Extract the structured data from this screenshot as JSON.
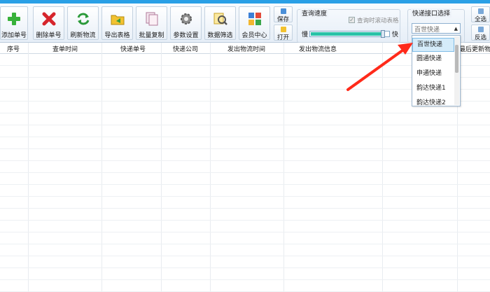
{
  "toolbar": {
    "buttons": [
      {
        "label": "添加单号",
        "icon": "plus-icon"
      },
      {
        "label": "删除单号",
        "icon": "delete-icon"
      },
      {
        "label": "刷新物流",
        "icon": "refresh-icon"
      },
      {
        "label": "导出表格",
        "icon": "export-icon"
      },
      {
        "label": "批量复制",
        "icon": "copy-icon"
      },
      {
        "label": "参数设置",
        "icon": "gear-icon"
      },
      {
        "label": "数据筛选",
        "icon": "filter-icon"
      },
      {
        "label": "会员中心",
        "icon": "members-icon"
      }
    ],
    "save_label": "保存",
    "open_label": "打开",
    "select_all_label": "全选",
    "invert_label": "反选"
  },
  "speed": {
    "title": "查询速度",
    "scroll_checkbox_label": "查询时滚动表格",
    "slow_label": "慢",
    "fast_label": "快",
    "level": 0.94
  },
  "courier_select": {
    "title": "快递接口选择",
    "value": "百世快递",
    "options": [
      "百世快递",
      "圆通快递",
      "申通快递",
      "韵达快递1",
      "韵达快递2"
    ],
    "selected_index": 0
  },
  "table": {
    "columns": [
      "序号",
      "查单时间",
      "快递单号",
      "快递公司",
      "发出物流时间",
      "发出物流信息",
      "最后更新物"
    ]
  },
  "colors": {
    "accent": "#2aa0e6",
    "speed_fill": "#29c2a8",
    "arrow": "#ff2a1a",
    "selected_option": "#d5ecfa"
  }
}
